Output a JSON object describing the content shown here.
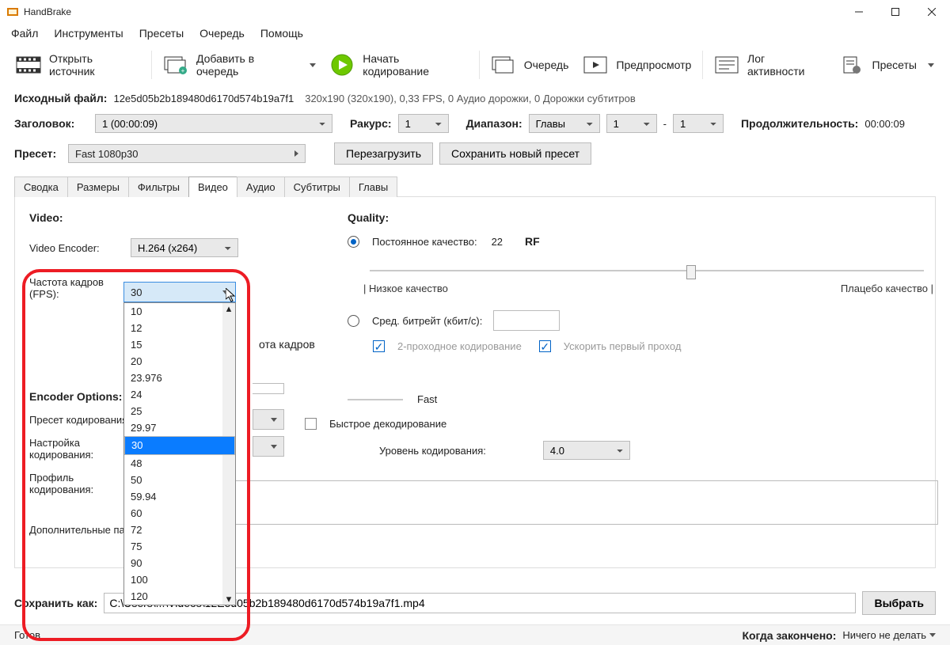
{
  "window": {
    "title": "HandBrake"
  },
  "menus": [
    "Файл",
    "Инструменты",
    "Пресеты",
    "Очередь",
    "Помощь"
  ],
  "toolbar": {
    "open": {
      "label": "Открыть источник"
    },
    "add": {
      "label": "Добавить в очередь"
    },
    "start": {
      "label": "Начать кодирование"
    },
    "queue": {
      "label": "Очередь"
    },
    "preview": {
      "label": "Предпросмотр"
    },
    "log": {
      "label": "Лог активности"
    },
    "presets": {
      "label": "Пресеты"
    }
  },
  "source": {
    "label": "Исходный файл:",
    "filename": "12e5d05b2b189480d6170d574b19a7f1",
    "info": "320x190 (320x190), 0,33 FPS, 0 Аудио дорожки, 0 Дорожки субтитров"
  },
  "title_row": {
    "title_label": "Заголовок:",
    "title_value": "1  (00:00:09)",
    "angle_label": "Ракурс:",
    "angle_value": "1",
    "range_label": "Диапазон:",
    "range_type": "Главы",
    "from": "1",
    "dash": "-",
    "to": "1",
    "duration_label": "Продолжительность:",
    "duration_value": "00:00:09"
  },
  "preset_row": {
    "label": "Пресет:",
    "value": "Fast 1080p30",
    "reload": "Перезагрузить",
    "save_new": "Сохранить новый пресет"
  },
  "tabs": {
    "items": [
      "Сводка",
      "Размеры",
      "Фильтры",
      "Видео",
      "Аудио",
      "Субтитры",
      "Главы"
    ],
    "active_index": 3
  },
  "video_tab": {
    "video_section": "Video:",
    "encoder_label": "Video Encoder:",
    "encoder_value": "H.264 (x264)",
    "fps_label": "Частота кадров (FPS):",
    "fps_current": "30",
    "fps_options": [
      "10",
      "12",
      "15",
      "20",
      "23.976",
      "24",
      "25",
      "29.97",
      "30",
      "48",
      "50",
      "59.94",
      "60",
      "72",
      "75",
      "90",
      "100",
      "120"
    ],
    "fps_partial_text": "ота кадров",
    "quality_section": "Quality:",
    "cq_label": "Постоянное качество:",
    "cq_value": "22",
    "cq_unit": "RF",
    "lo_quality": "| Низкое качество",
    "placebo": "Плацебо качество |",
    "avg_label": "Сред. битрейт (кбит/с):",
    "twopass": "2-проходное кодирование",
    "turbo": "Ускорить первый проход",
    "encoder_options": "Encoder Options:",
    "enc_preset": "Пресет кодирования:",
    "enc_preset_value": "Fast",
    "enc_tune": "Настройка кодирования:",
    "fast_decode": "Быстрое декодирование",
    "enc_profile": "Профиль кодирования:",
    "enc_level_label": "Уровень кодирования:",
    "enc_level_value": "4.0",
    "extra_label": "Дополнительные параметры:"
  },
  "save_row": {
    "label": "Сохранить как:",
    "path": "C:\\Users\\...\\Videos\\12E5d05b2b189480d6170d574b19a7f1.mp4",
    "browse": "Выбрать"
  },
  "status": {
    "ready": "Готов",
    "when_done_label": "Когда закончено:",
    "when_done_value": "Ничего не делать"
  }
}
